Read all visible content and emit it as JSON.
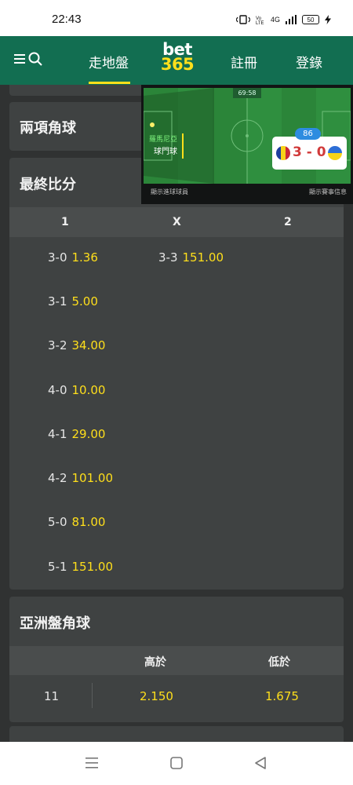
{
  "status_bar": {
    "time": "22:43",
    "network": "4G",
    "battery": "50"
  },
  "header": {
    "nav_live": "走地盤",
    "logo_top": "bet",
    "logo_bottom": "365",
    "nav_register": "註冊",
    "nav_login": "登錄",
    "accent": "#ffdf1b",
    "brand_green": "#126e51"
  },
  "video": {
    "timer": "69:58",
    "event_team": "羅馬尼亞",
    "event_label": "球門球",
    "minute": "86",
    "score": "3 - 0",
    "footer_left": "顯示進球球員",
    "footer_right": "顯示賽事信息"
  },
  "markets": {
    "both_corners_title": "兩項角球",
    "final_score_title": "最終比分",
    "columns": [
      "1",
      "X",
      "2"
    ],
    "home_scores": [
      {
        "score": "3-0",
        "odds": "1.36"
      },
      {
        "score": "3-1",
        "odds": "5.00"
      },
      {
        "score": "3-2",
        "odds": "34.00"
      },
      {
        "score": "4-0",
        "odds": "10.00"
      },
      {
        "score": "4-1",
        "odds": "29.00"
      },
      {
        "score": "4-2",
        "odds": "101.00"
      },
      {
        "score": "5-0",
        "odds": "81.00"
      },
      {
        "score": "5-1",
        "odds": "151.00"
      }
    ],
    "draw_scores": [
      {
        "score": "3-3",
        "odds": "151.00"
      }
    ],
    "asian_corners_title": "亞洲盤角球",
    "asian_columns": [
      "高於",
      "低於"
    ],
    "asian_row": {
      "line": "11",
      "over": "2.150",
      "under": "1.675"
    }
  }
}
